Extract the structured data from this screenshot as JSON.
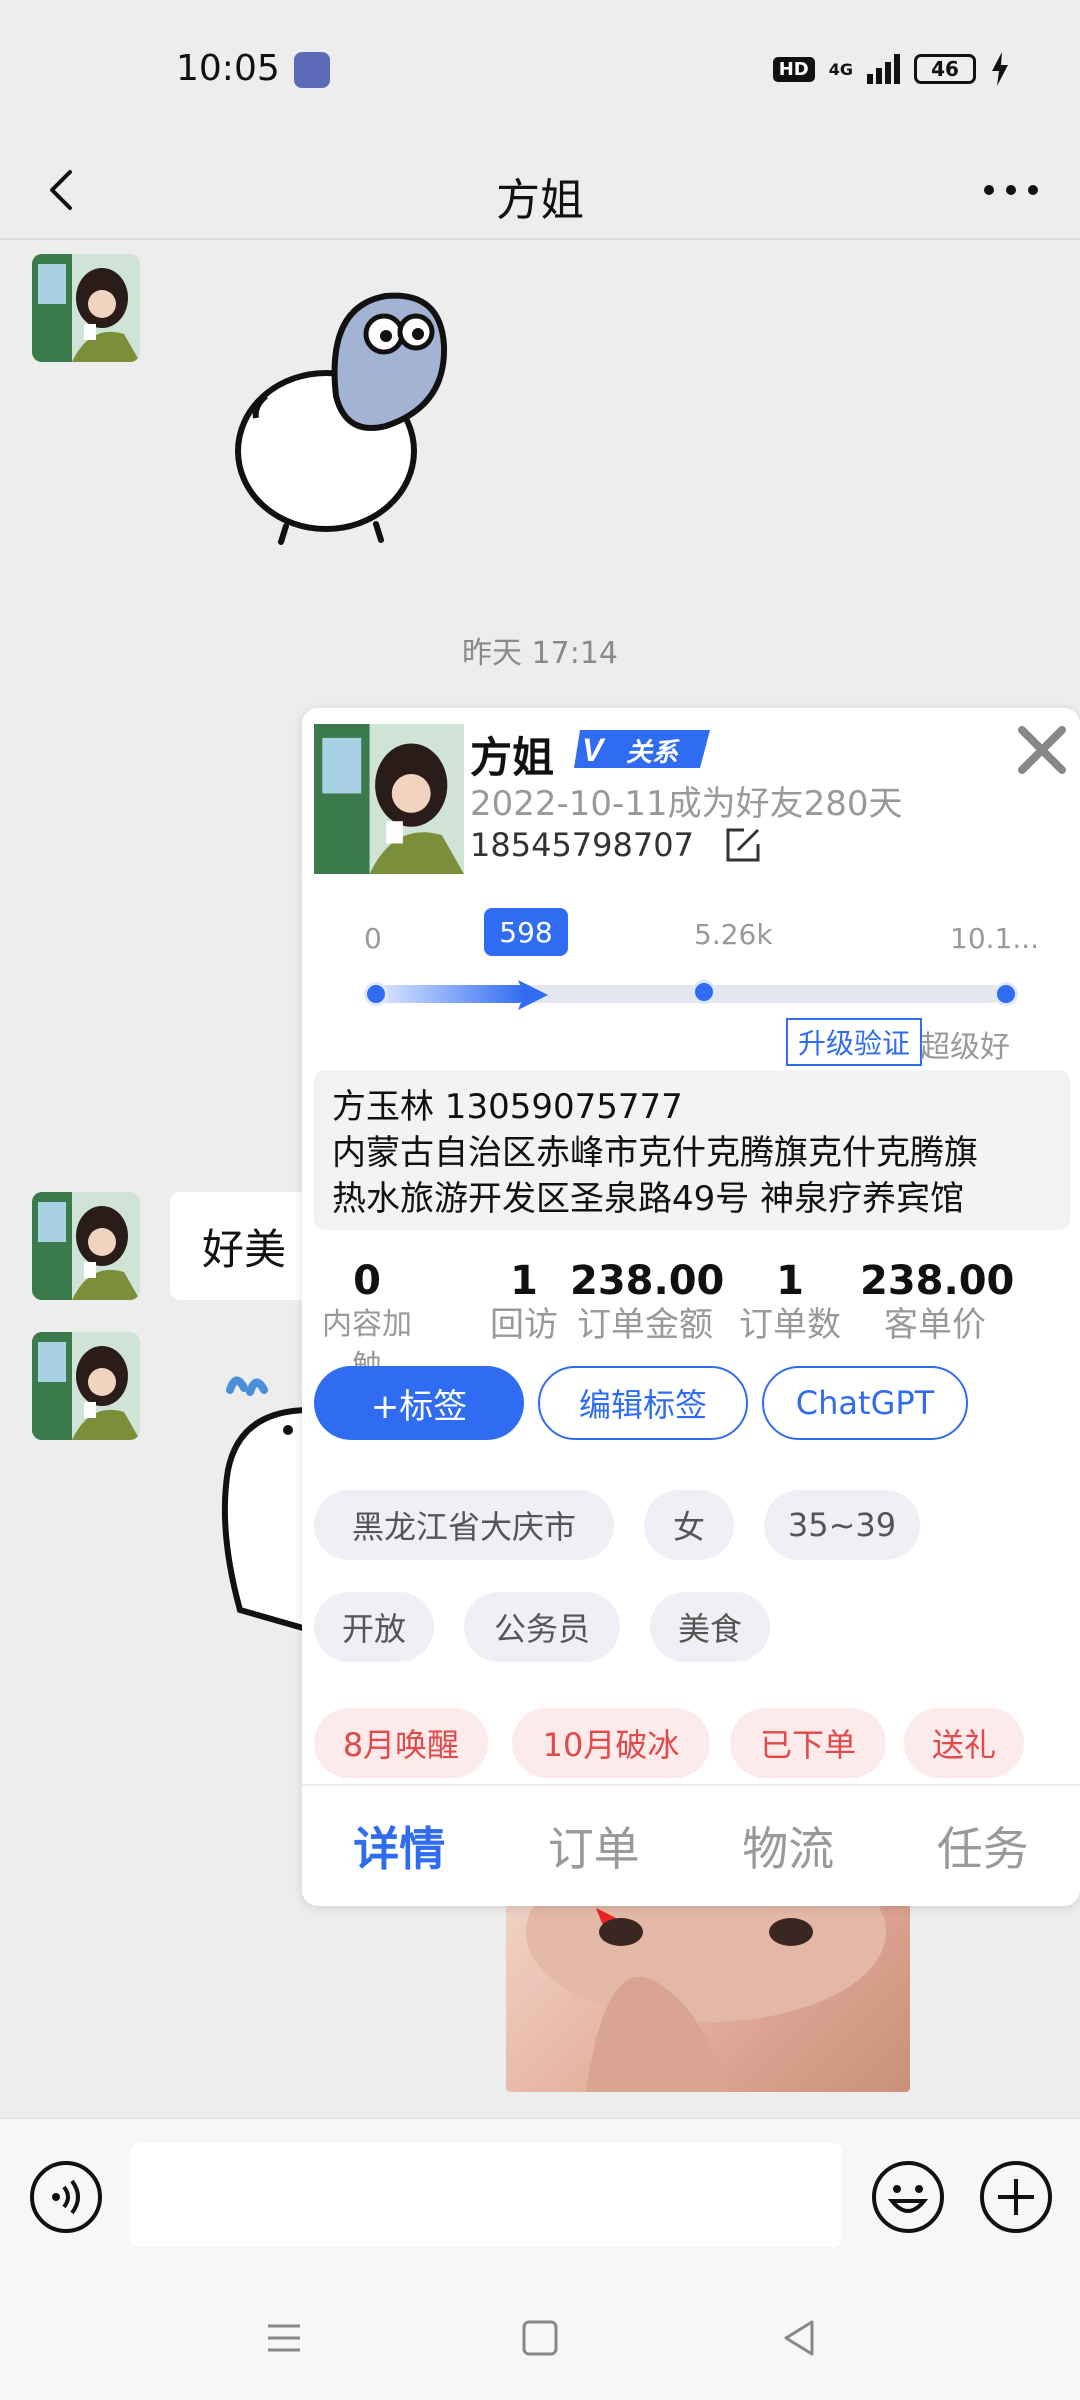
{
  "status_bar": {
    "time": "10:05",
    "hd": "HD",
    "network": "4G",
    "battery": "46"
  },
  "header": {
    "title": "方姐"
  },
  "chat": {
    "time_divider": "昨天 17:14",
    "text_message": "好美"
  },
  "card": {
    "name": "方姐",
    "badge": "关系",
    "friend_since": "2022-10-11成为好友280天",
    "phone": "18545798707",
    "progress": {
      "ticks": [
        "0",
        "5.26k",
        "10.1..."
      ],
      "current": "598",
      "current_fraction": 0.24,
      "upgrade_label": "升级验证",
      "super_label": "超级好友"
    },
    "address": {
      "line1": "方玉林 13059075777",
      "line2": "内蒙古自治区赤峰市克什克腾旗克什克腾旗",
      "line3": "热水旅游开发区圣泉路49号 神泉疗养宾馆"
    },
    "stats": [
      {
        "value": "0",
        "label": "内容加触"
      },
      {
        "value": "1",
        "label": "回访"
      },
      {
        "value": "238.00",
        "label": "订单金额"
      },
      {
        "value": "1",
        "label": "订单数"
      },
      {
        "value": "238.00",
        "label": "客单价"
      }
    ],
    "actions": {
      "add_tag": "+标签",
      "edit_tag": "编辑标签",
      "chatgpt": "ChatGPT"
    },
    "tags_row1": [
      "黑龙江省大庆市",
      "女",
      "35~39"
    ],
    "tags_row2": [
      "开放",
      "公务员",
      "美食"
    ],
    "tags_red": [
      "8月唤醒",
      "10月破冰",
      "已下单",
      "送礼"
    ],
    "tabs": [
      "详情",
      "订单",
      "物流",
      "任务"
    ]
  },
  "colors": {
    "accent": "#2f6cf2",
    "red_tag": "#e04a4a",
    "background": "#ededed"
  }
}
